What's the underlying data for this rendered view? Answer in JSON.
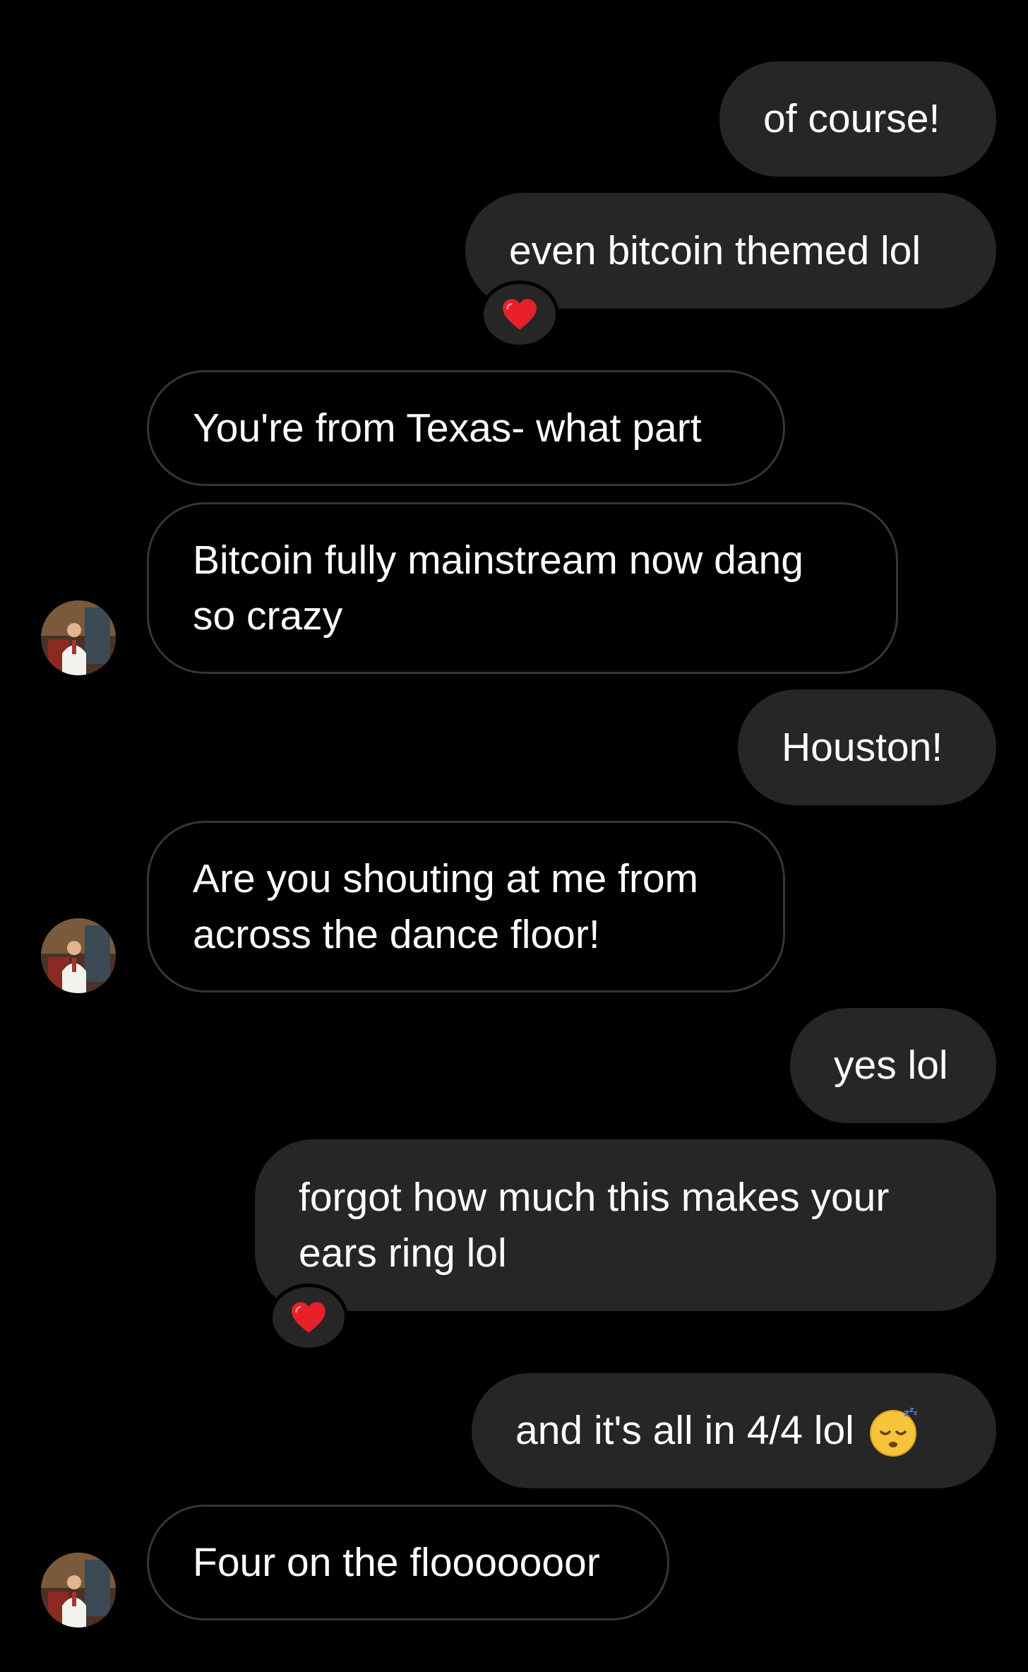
{
  "messages": [
    {
      "side": "sent",
      "text": "of course!"
    },
    {
      "side": "sent",
      "text": "even bitcoin themed lol",
      "reaction": "heart"
    },
    {
      "side": "received",
      "text": "You're from Texas- what part"
    },
    {
      "side": "received",
      "text": "Bitcoin fully mainstream now dang so crazy"
    },
    {
      "side": "sent",
      "text": "Houston!"
    },
    {
      "side": "received",
      "text": "Are you shouting at me from across the dance floor!"
    },
    {
      "side": "sent",
      "text": "yes lol"
    },
    {
      "side": "sent",
      "text": "forgot how much this makes your ears ring lol",
      "reaction": "heart"
    },
    {
      "side": "sent",
      "text": "and it's all in 4/4 lol",
      "emoji": "sleeping-face"
    },
    {
      "side": "received",
      "text": "Four on the flooooooor"
    }
  ],
  "colors": {
    "background": "#000000",
    "sent_bubble": "#262626",
    "received_border": "#363636",
    "text": "#ffffff",
    "heart": "#e8202a"
  }
}
